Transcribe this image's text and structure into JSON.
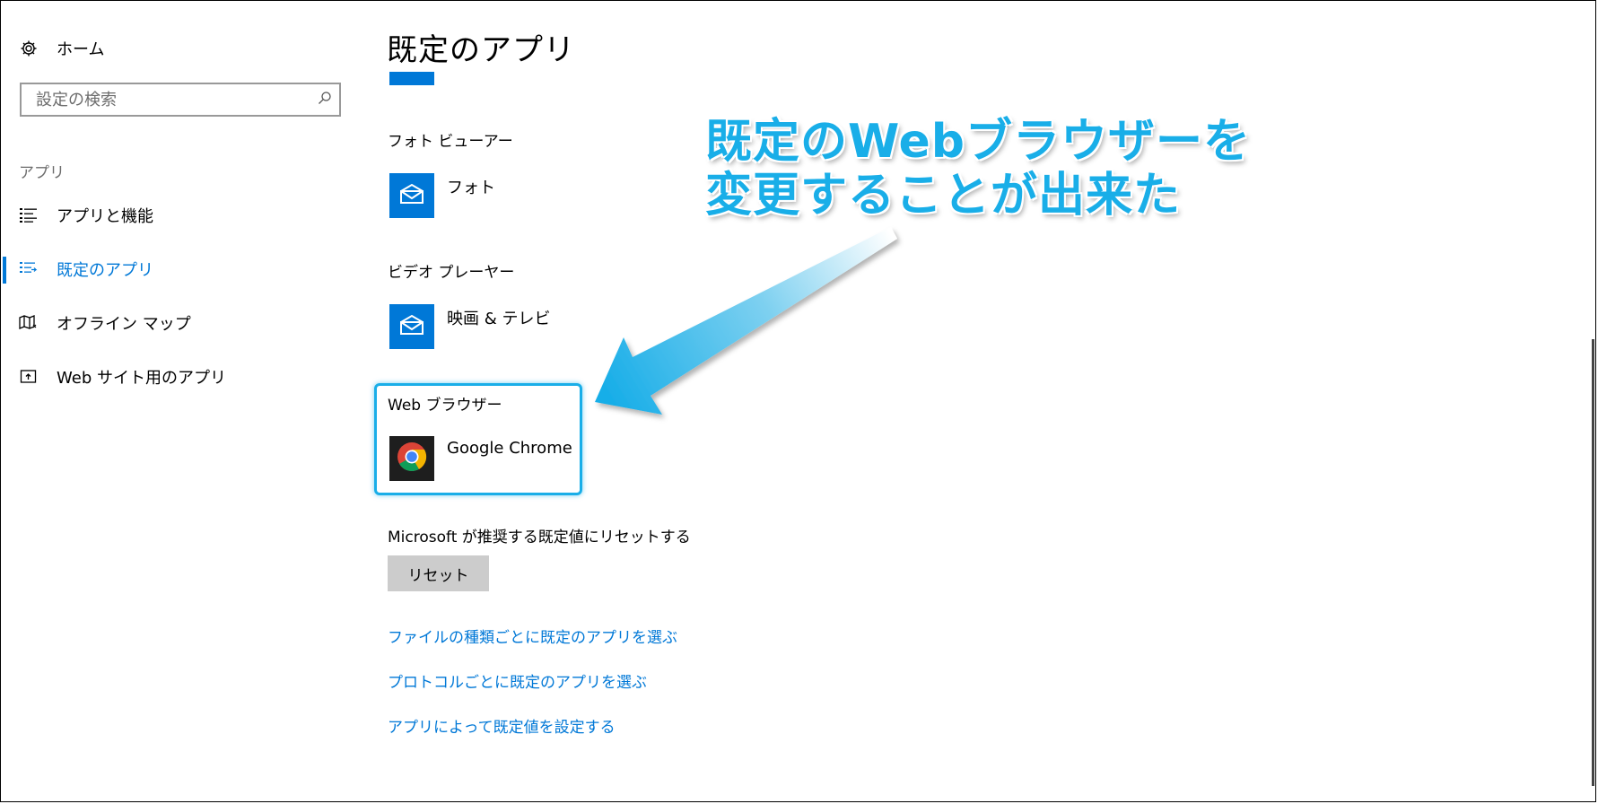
{
  "sidebar": {
    "home_label": "ホーム",
    "search_placeholder": "設定の検索",
    "section_label": "アプリ",
    "items": [
      {
        "label": "アプリと機能",
        "icon": "list-icon"
      },
      {
        "label": "既定のアプリ",
        "icon": "default-apps-icon",
        "active": true
      },
      {
        "label": "オフライン マップ",
        "icon": "map-icon"
      },
      {
        "label": "Web サイト用のアプリ",
        "icon": "web-app-icon"
      }
    ]
  },
  "main": {
    "title": "既定のアプリ",
    "categories": [
      {
        "label": "フォト ビューアー",
        "app": "フォト",
        "icon": "photo-app-icon"
      },
      {
        "label": "ビデオ プレーヤー",
        "app": "映画 & テレビ",
        "icon": "movies-tv-icon"
      },
      {
        "label": "Web ブラウザー",
        "app": "Google Chrome",
        "icon": "chrome-icon"
      }
    ],
    "reset_label": "Microsoft が推奨する既定値にリセットする",
    "reset_button": "リセット",
    "links": [
      "ファイルの種類ごとに既定のアプリを選ぶ",
      "プロトコルごとに既定のアプリを選ぶ",
      "アプリによって既定値を設定する"
    ]
  },
  "annotation": {
    "line1": "既定のWebブラウザーを",
    "line2": "変更することが出来た",
    "color": "#19aee8"
  },
  "colors": {
    "accent": "#0078d7",
    "highlight": "#19aee8",
    "button_bg": "#cccccc"
  }
}
